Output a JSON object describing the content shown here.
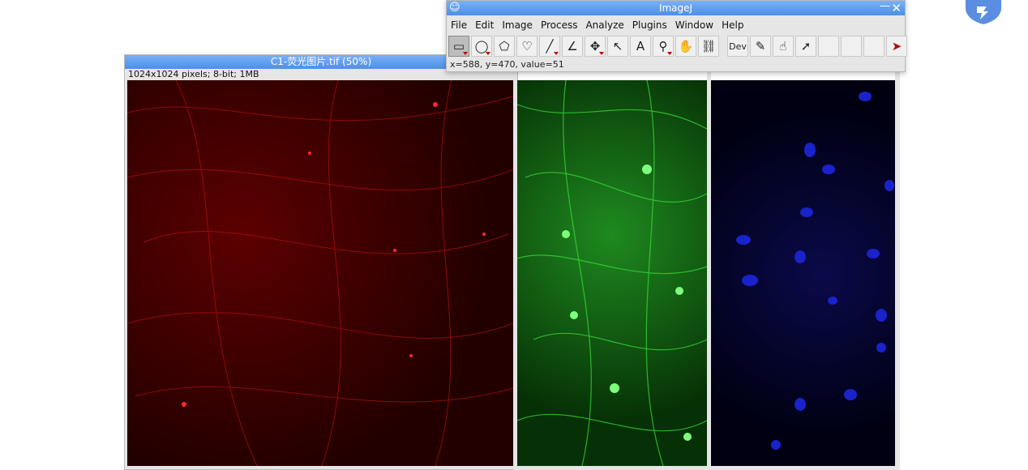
{
  "image_window": {
    "title": "C1-荧光图片.tif (50%)",
    "info": "1024x1024 pixels; 8-bit; 1MB"
  },
  "imagej": {
    "title": "ImageJ",
    "menu": [
      "File",
      "Edit",
      "Image",
      "Process",
      "Analyze",
      "Plugins",
      "Window",
      "Help"
    ],
    "status": "x=588, y=470, value=51",
    "tool_more": "➤",
    "tool_dev": "Dev"
  }
}
